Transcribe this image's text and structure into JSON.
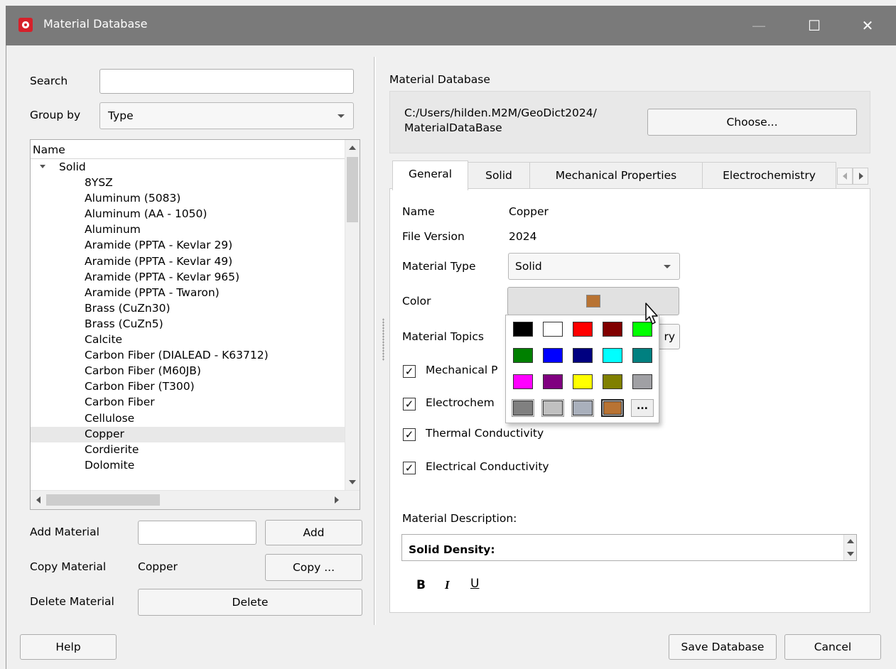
{
  "window": {
    "title": "Material Database",
    "minimize": "—",
    "maximize": "☐",
    "close": "✕"
  },
  "left": {
    "search_label": "Search",
    "search_value": "",
    "groupby_label": "Group by",
    "groupby_value": "Type",
    "tree_header": "Name",
    "group": "Solid",
    "items": [
      "8YSZ",
      "Aluminum (5083)",
      "Aluminum (AA - 1050)",
      "Aluminum",
      "Aramide (PPTA - Kevlar 29)",
      "Aramide (PPTA - Kevlar 49)",
      "Aramide (PPTA - Kevlar 965)",
      "Aramide (PPTA - Twaron)",
      "Brass (CuZn30)",
      "Brass (CuZn5)",
      "Calcite",
      "Carbon Fiber (DIALEAD - K63712)",
      "Carbon Fiber (M60JB)",
      "Carbon Fiber (T300)",
      "Carbon Fiber",
      "Cellulose",
      "Copper",
      "Cordierite",
      "Dolomite"
    ],
    "selected_item": "Copper",
    "add_label": "Add Material",
    "add_value": "",
    "add_button": "Add",
    "copy_label": "Copy Material",
    "copy_value": "Copper",
    "copy_button": "Copy ...",
    "delete_label": "Delete Material",
    "delete_button": "Delete"
  },
  "right": {
    "db_label": "Material Database",
    "db_path_line1": "C:/Users/hilden.M2M/GeoDict2024/",
    "db_path_line2": "MaterialDataBase",
    "choose_button": "Choose...",
    "tabs": [
      "General",
      "Solid",
      "Mechanical Properties",
      "Electrochemistry"
    ],
    "active_tab": "General",
    "name_label": "Name",
    "name_value": "Copper",
    "version_label": "File Version",
    "version_value": "2024",
    "type_label": "Material Type",
    "type_value": "Solid",
    "color_label": "Color",
    "color_value": "#b87333",
    "topics_label": "Material Topics",
    "topics_button_visible": "ry",
    "checks": [
      "Mechanical P",
      "Electrochem",
      "Thermal Conductivity",
      "Electrical Conductivity"
    ],
    "description_label": "Material Description:",
    "description_heading": "Solid Density:",
    "fmt_bold": "B",
    "fmt_italic": "I",
    "fmt_underline": "U"
  },
  "palette": {
    "colors": [
      "#000000",
      "#ffffff",
      "#ff0000",
      "#800000",
      "#00ff00",
      "#008000",
      "#0000ff",
      "#000080",
      "#00ffff",
      "#008080",
      "#ff00ff",
      "#800080",
      "#ffff00",
      "#808000",
      "#a0a0a4",
      "#808080",
      "#c0c0c0",
      "#a9b0bc",
      "#b87333"
    ],
    "more": "..."
  },
  "footer": {
    "help": "Help",
    "save": "Save Database",
    "cancel": "Cancel"
  }
}
